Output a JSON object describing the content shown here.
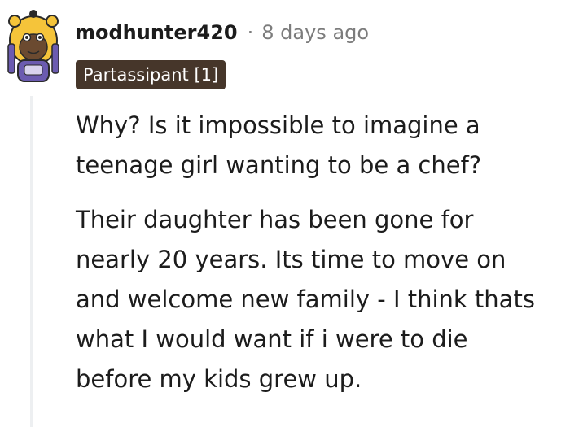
{
  "comment": {
    "author": "modhunter420",
    "separator": "·",
    "timestamp": "8 days ago",
    "flair": "Partassipant [1]",
    "paragraphs": [
      {
        "lines": [
          "Why? Is it impossible to imagine a",
          "teenage girl wanting to be a chef?"
        ]
      },
      {
        "lines": [
          "Their daughter has been gone for",
          "nearly 20 years. Its time to move on",
          "and welcome new family - I think thats",
          "what I would want if i were to die",
          "before my kids grew up."
        ]
      }
    ]
  },
  "colors": {
    "flair_bg": "#46362a",
    "meta_text": "#7c7c7c",
    "thread_line": "#edeff1",
    "avatar_yellow": "#f5c43a",
    "avatar_purple": "#6b5bb0"
  },
  "icons": {
    "avatar": "user-avatar-snoo-lion-costume"
  }
}
